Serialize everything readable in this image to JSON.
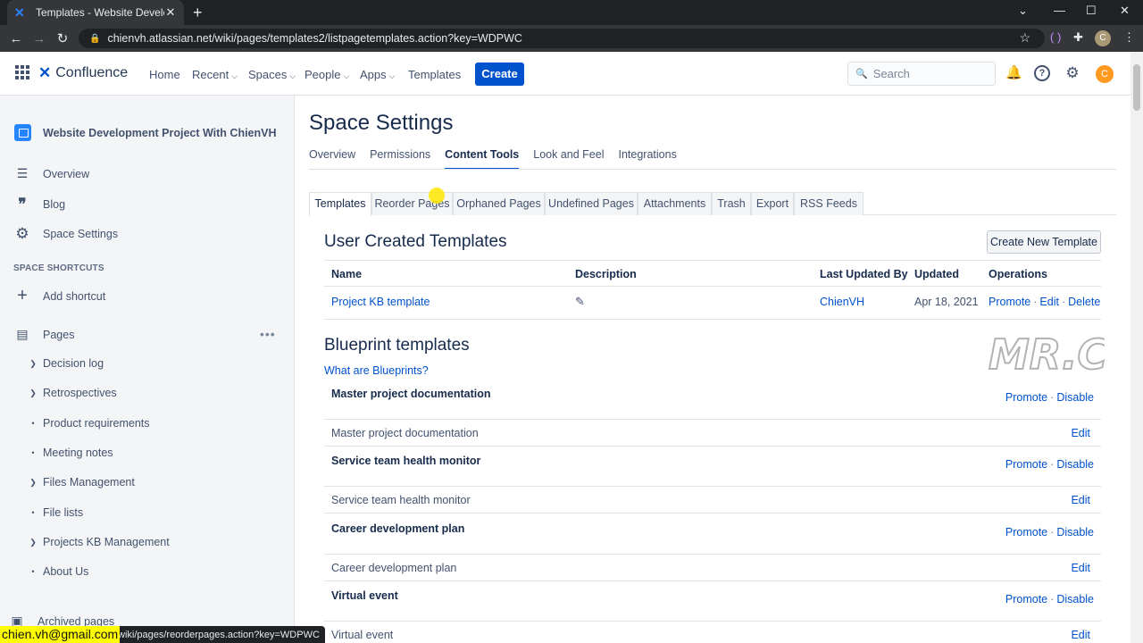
{
  "browser": {
    "tab_title": "Templates - Website Developme",
    "url": "chienvh.atlassian.net/wiki/pages/templates2/listpagetemplates.action?key=WDPWC",
    "profile_initial": "C"
  },
  "header": {
    "product": "Confluence",
    "nav": [
      "Home",
      "Recent",
      "Spaces",
      "People",
      "Apps",
      "Templates"
    ],
    "create_label": "Create",
    "search_placeholder": "Search",
    "avatar_initial": "C"
  },
  "sidebar": {
    "space_name": "Website Development Project With ChienVH",
    "items": [
      "Overview",
      "Blog",
      "Space Settings"
    ],
    "shortcuts_heading": "SPACE SHORTCUTS",
    "add_shortcut": "Add shortcut",
    "pages_label": "Pages",
    "tree": [
      {
        "label": "Decision log",
        "expandable": true
      },
      {
        "label": "Retrospectives",
        "expandable": true
      },
      {
        "label": "Product requirements",
        "expandable": false
      },
      {
        "label": "Meeting notes",
        "expandable": false
      },
      {
        "label": "Files Management",
        "expandable": true
      },
      {
        "label": "File lists",
        "expandable": false
      },
      {
        "label": "Projects KB Management",
        "expandable": true
      },
      {
        "label": "About Us",
        "expandable": false
      }
    ],
    "archived": "Archived pages"
  },
  "status": {
    "url": "wiki/pages/reorderpages.action?key=WDPWC",
    "email": "chien.vh@gmail.com"
  },
  "main": {
    "title": "Space Settings",
    "settings_tabs": [
      "Overview",
      "Permissions",
      "Content Tools",
      "Look and Feel",
      "Integrations"
    ],
    "active_settings_tab": "Content Tools",
    "content_tabs": [
      "Templates",
      "Reorder Pages",
      "Orphaned Pages",
      "Undefined Pages",
      "Attachments",
      "Trash",
      "Export",
      "RSS Feeds"
    ],
    "active_content_tab": "Templates",
    "user_templates_heading": "User Created Templates",
    "create_template_label": "Create New Template",
    "table_headers": [
      "Name",
      "Description",
      "Last Updated By",
      "Updated",
      "Operations"
    ],
    "user_templates": [
      {
        "name": "Project KB template",
        "updated_by": "ChienVH",
        "updated": "Apr 18, 2021",
        "promote": "Promote",
        "edit": "Edit",
        "delete": "Delete"
      }
    ],
    "blueprint_heading": "Blueprint templates",
    "what_are_blueprints": "What are Blueprints?",
    "watermark_text": "MR.C",
    "blueprints": [
      {
        "group": "Master project documentation",
        "item": "Master project documentation"
      },
      {
        "group": "Service team health monitor",
        "item": "Service team health monitor"
      },
      {
        "group": "Career development plan",
        "item": "Career development plan"
      },
      {
        "group": "Virtual event",
        "item": "Virtual event"
      }
    ],
    "promote_label": "Promote",
    "disable_label": "Disable",
    "edit_label": "Edit"
  }
}
